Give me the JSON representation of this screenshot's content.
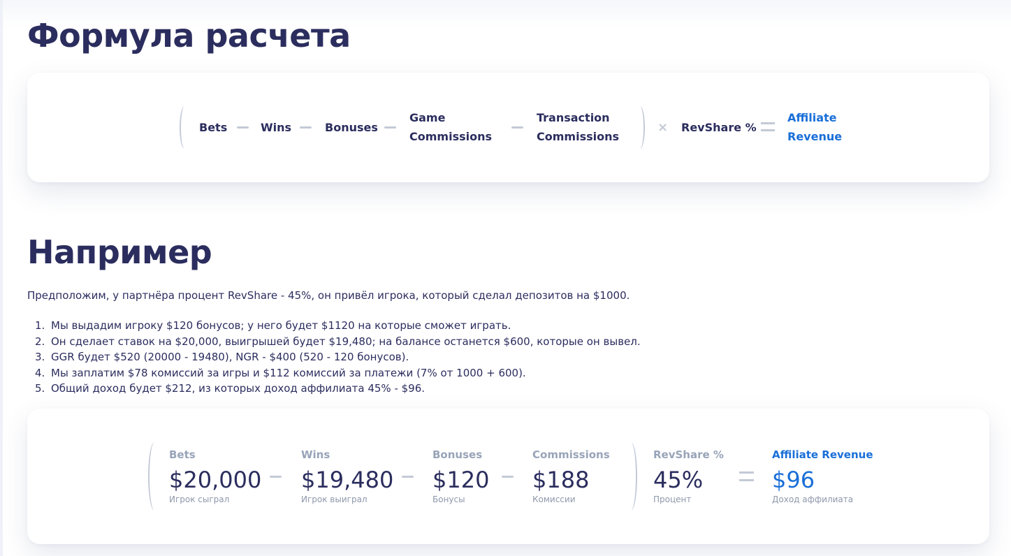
{
  "formula": {
    "title": "Формула расчета",
    "terms": [
      {
        "label": "Bets"
      },
      {
        "label": "Wins"
      },
      {
        "label": "Bonuses"
      },
      {
        "label": "Game\nCommissions"
      },
      {
        "label": "Transaction\nCommissions"
      }
    ],
    "multiplier": "RevShare %",
    "result": "Affiliate\nRevenue",
    "colors": {
      "accent": "#1a6fd8",
      "operator": "#c3cad6",
      "text": "#2b2d5e"
    }
  },
  "example": {
    "title": "Например",
    "intro": "Предположим, у партнёра процент RevShare - 45%, он привёл игрока, который сделал депозитов на $1000.",
    "steps": [
      {
        "num": "1.",
        "text": "Мы выдадим игроку $120 бонусов; у него будет $1120 на которые сможет играть."
      },
      {
        "num": "2.",
        "text": "Он сделает ставок на $20,000, выигрышей будет $19,480; на балансе останется $600, которые он вывел."
      },
      {
        "num": "3.",
        "text": "GGR будет $520 (20000 - 19480), NGR - $400 (520 - 120 бонусов)."
      },
      {
        "num": "4.",
        "text": "Мы заплатим $78 комиссий за игры и $112 комиссий за платежи (7% от 1000 + 600)."
      },
      {
        "num": "5.",
        "text": "Общий доход будет $212, из которых доход аффилиата 45% - $96."
      }
    ],
    "calc": {
      "bets": {
        "label": "Bets",
        "value": "$20,000",
        "sub": "Игрок сыграл"
      },
      "wins": {
        "label": "Wins",
        "value": "$19,480",
        "sub": "Игрок выиграл"
      },
      "bonuses": {
        "label": "Bonuses",
        "value": "$120",
        "sub": "Бонусы"
      },
      "commissions": {
        "label": "Commissions",
        "value": "$188",
        "sub": "Комиссии"
      },
      "revshare": {
        "label": "RevShare %",
        "value": "45%",
        "sub": "Процент"
      },
      "result": {
        "label": "Affiliate Revenue",
        "value": "$96",
        "sub": "Доход аффилиата"
      }
    }
  }
}
